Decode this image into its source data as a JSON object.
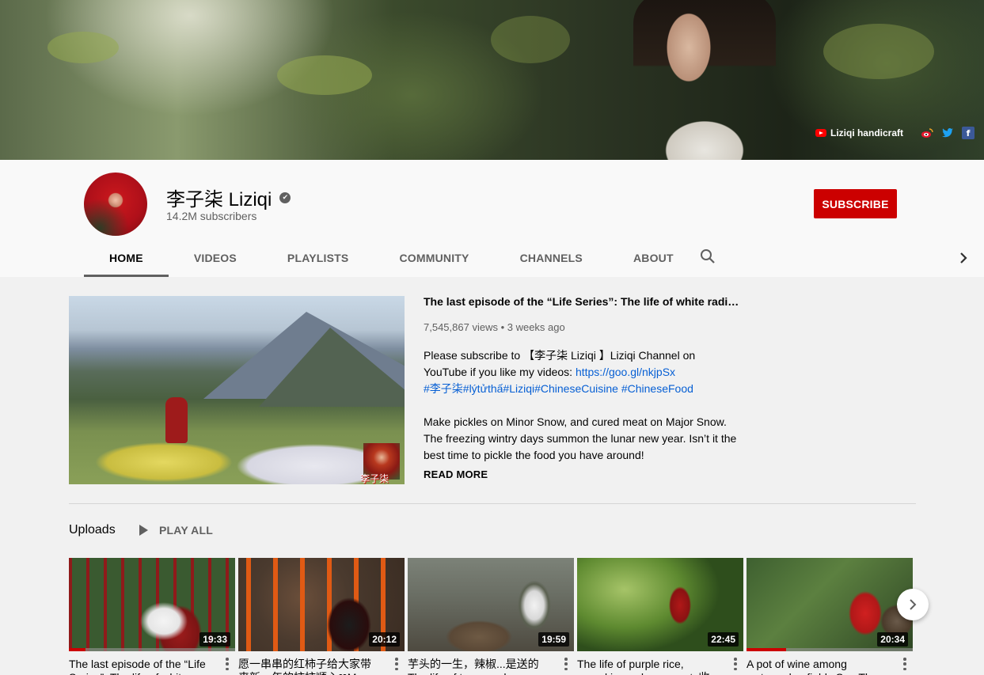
{
  "banner": {
    "links": [
      {
        "label": "Liziqi handicraft",
        "icon": "youtube-icon"
      },
      {
        "icon": "weibo-icon"
      },
      {
        "icon": "twitter-icon"
      },
      {
        "icon": "facebook-icon"
      }
    ],
    "facebook_glyph": "f"
  },
  "channel": {
    "name": "李子柒 Liziqi",
    "subscribers": "14.2M subscribers",
    "verified_icon": "check-circle-icon",
    "verified_glyph": "✔",
    "subscribe_label": "SUBSCRIBE"
  },
  "tabs": [
    {
      "label": "HOME",
      "active": true
    },
    {
      "label": "VIDEOS",
      "active": false
    },
    {
      "label": "PLAYLISTS",
      "active": false
    },
    {
      "label": "COMMUNITY",
      "active": false
    },
    {
      "label": "CHANNELS",
      "active": false
    },
    {
      "label": "ABOUT",
      "active": false
    }
  ],
  "featured": {
    "title": "The last episode of the “Life Series”: The life of white radish!…",
    "views": "7,545,867 views",
    "meta_separator": " • ",
    "age": "3 weeks ago",
    "thumb_logo_text": "李子柒",
    "desc": {
      "line1_a": "Please  subscribe to 【李子柒 Liziqi 】Liziqi Channel on YouTube if you like my videos: ",
      "line1_link": "https://goo.gl/nkjpSx",
      "hashtags": "#李子柒#lýtửthấ#Liziqi#ChineseCuisine #ChineseFood",
      "para2": "Make pickles on Minor Snow, and cured meat on Major Snow. The freezing wintry days summon the lunar new year. Isn’t it the best time to pickle the food you have around!"
    },
    "read_more": "READ MORE"
  },
  "uploads": {
    "title": "Uploads",
    "play_all": "PLAY ALL",
    "videos": [
      {
        "title": "The last episode of the “Life Series”: The life of white",
        "duration": "19:33",
        "progress": 0.1
      },
      {
        "title": "愿一串串的红柿子给大家带来新一年的柿柿顺心❤May the",
        "duration": "20:12",
        "progress": 0.0
      },
      {
        "title": "芋头的一生，辣椒...是送的 The life of taro...and pepper",
        "duration": "19:59",
        "progress": 0.0
      },
      {
        "title": "The life of purple rice, pumpkin, and ... peanuts收",
        "duration": "22:45",
        "progress": 0.0
      },
      {
        "title": "A pot of wine among watermelon fields So.. The",
        "duration": "20:34",
        "progress": 0.24
      }
    ]
  },
  "colors": {
    "accent_red": "#cc0000",
    "link_blue": "#065fd4",
    "text_secondary": "#606060"
  }
}
